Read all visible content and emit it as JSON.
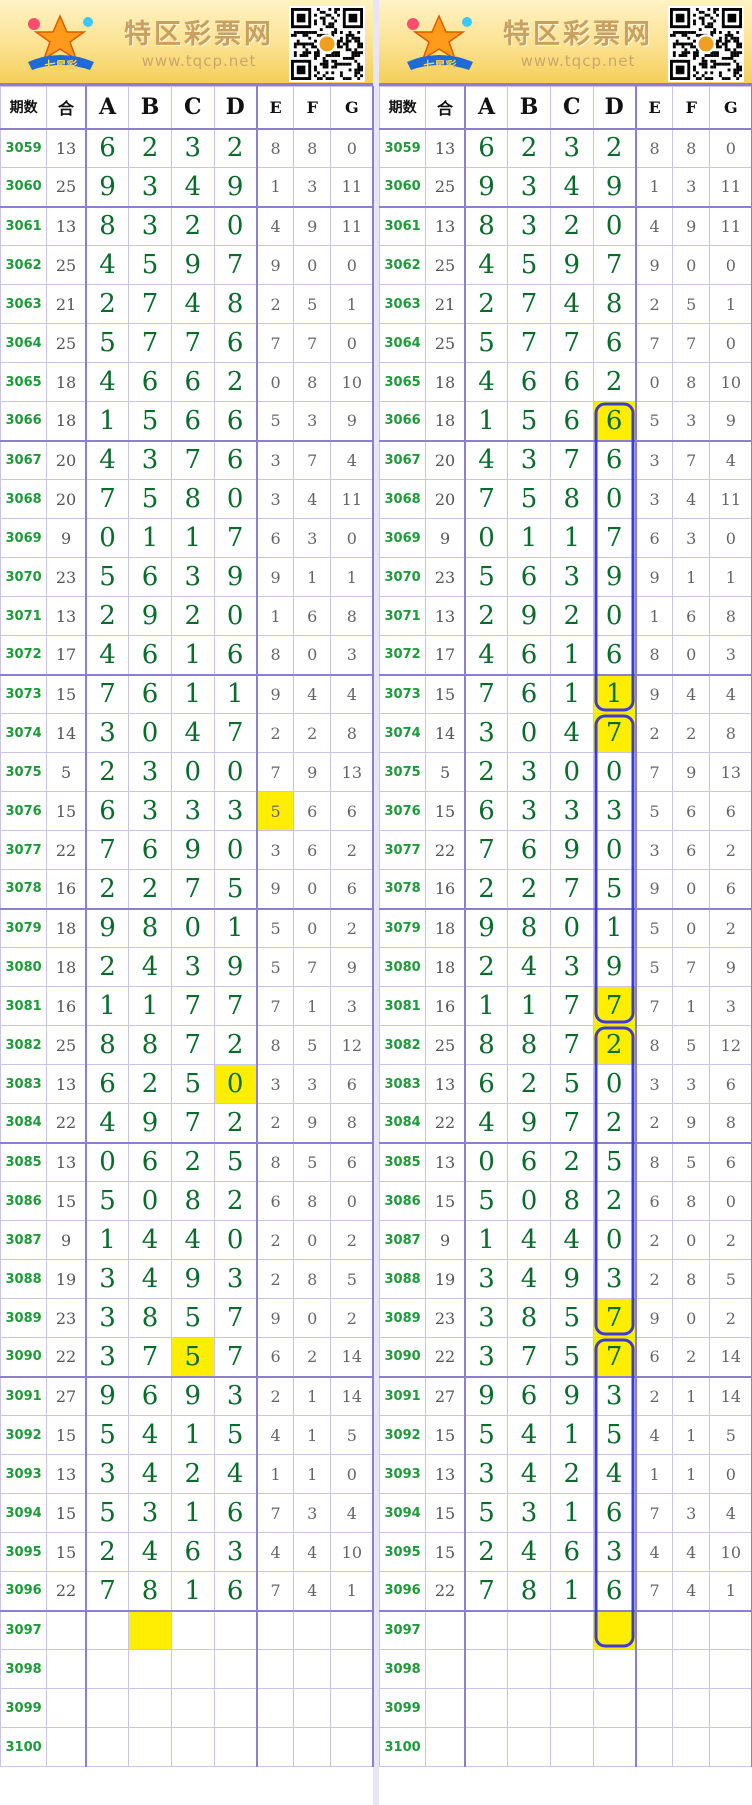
{
  "banner": {
    "title": "特区彩票网",
    "url": "www.tqcp.net",
    "logo_label": "七星彩"
  },
  "headers": [
    "期数",
    "合",
    "A",
    "B",
    "C",
    "D",
    "E",
    "F",
    "G"
  ],
  "rows": [
    {
      "p": "3059",
      "s": "13",
      "m": [
        "6",
        "2",
        "3",
        "2"
      ],
      "e": [
        "8",
        "8",
        "0"
      ]
    },
    {
      "p": "3060",
      "s": "25",
      "m": [
        "9",
        "3",
        "4",
        "9"
      ],
      "e": [
        "1",
        "3",
        "11"
      ]
    },
    {
      "p": "3061",
      "s": "13",
      "m": [
        "8",
        "3",
        "2",
        "0"
      ],
      "e": [
        "4",
        "9",
        "11"
      ]
    },
    {
      "p": "3062",
      "s": "25",
      "m": [
        "4",
        "5",
        "9",
        "7"
      ],
      "e": [
        "9",
        "0",
        "0"
      ]
    },
    {
      "p": "3063",
      "s": "21",
      "m": [
        "2",
        "7",
        "4",
        "8"
      ],
      "e": [
        "2",
        "5",
        "1"
      ]
    },
    {
      "p": "3064",
      "s": "25",
      "m": [
        "5",
        "7",
        "7",
        "6"
      ],
      "e": [
        "7",
        "7",
        "0"
      ]
    },
    {
      "p": "3065",
      "s": "18",
      "m": [
        "4",
        "6",
        "6",
        "2"
      ],
      "e": [
        "0",
        "8",
        "10"
      ]
    },
    {
      "p": "3066",
      "s": "18",
      "m": [
        "1",
        "5",
        "6",
        "6"
      ],
      "e": [
        "5",
        "3",
        "9"
      ]
    },
    {
      "p": "3067",
      "s": "20",
      "m": [
        "4",
        "3",
        "7",
        "6"
      ],
      "e": [
        "3",
        "7",
        "4"
      ]
    },
    {
      "p": "3068",
      "s": "20",
      "m": [
        "7",
        "5",
        "8",
        "0"
      ],
      "e": [
        "3",
        "4",
        "11"
      ]
    },
    {
      "p": "3069",
      "s": "9",
      "m": [
        "0",
        "1",
        "1",
        "7"
      ],
      "e": [
        "6",
        "3",
        "0"
      ]
    },
    {
      "p": "3070",
      "s": "23",
      "m": [
        "5",
        "6",
        "3",
        "9"
      ],
      "e": [
        "9",
        "1",
        "1"
      ]
    },
    {
      "p": "3071",
      "s": "13",
      "m": [
        "2",
        "9",
        "2",
        "0"
      ],
      "e": [
        "1",
        "6",
        "8"
      ]
    },
    {
      "p": "3072",
      "s": "17",
      "m": [
        "4",
        "6",
        "1",
        "6"
      ],
      "e": [
        "8",
        "0",
        "3"
      ]
    },
    {
      "p": "3073",
      "s": "15",
      "m": [
        "7",
        "6",
        "1",
        "1"
      ],
      "e": [
        "9",
        "4",
        "4"
      ]
    },
    {
      "p": "3074",
      "s": "14",
      "m": [
        "3",
        "0",
        "4",
        "7"
      ],
      "e": [
        "2",
        "2",
        "8"
      ]
    },
    {
      "p": "3075",
      "s": "5",
      "m": [
        "2",
        "3",
        "0",
        "0"
      ],
      "e": [
        "7",
        "9",
        "13"
      ]
    },
    {
      "p": "3076",
      "s": "15",
      "m": [
        "6",
        "3",
        "3",
        "3"
      ],
      "e": [
        "5",
        "6",
        "6"
      ]
    },
    {
      "p": "3077",
      "s": "22",
      "m": [
        "7",
        "6",
        "9",
        "0"
      ],
      "e": [
        "3",
        "6",
        "2"
      ]
    },
    {
      "p": "3078",
      "s": "16",
      "m": [
        "2",
        "2",
        "7",
        "5"
      ],
      "e": [
        "9",
        "0",
        "6"
      ]
    },
    {
      "p": "3079",
      "s": "18",
      "m": [
        "9",
        "8",
        "0",
        "1"
      ],
      "e": [
        "5",
        "0",
        "2"
      ]
    },
    {
      "p": "3080",
      "s": "18",
      "m": [
        "2",
        "4",
        "3",
        "9"
      ],
      "e": [
        "5",
        "7",
        "9"
      ]
    },
    {
      "p": "3081",
      "s": "16",
      "m": [
        "1",
        "1",
        "7",
        "7"
      ],
      "e": [
        "7",
        "1",
        "3"
      ]
    },
    {
      "p": "3082",
      "s": "25",
      "m": [
        "8",
        "8",
        "7",
        "2"
      ],
      "e": [
        "8",
        "5",
        "12"
      ]
    },
    {
      "p": "3083",
      "s": "13",
      "m": [
        "6",
        "2",
        "5",
        "0"
      ],
      "e": [
        "3",
        "3",
        "6"
      ]
    },
    {
      "p": "3084",
      "s": "22",
      "m": [
        "4",
        "9",
        "7",
        "2"
      ],
      "e": [
        "2",
        "9",
        "8"
      ]
    },
    {
      "p": "3085",
      "s": "13",
      "m": [
        "0",
        "6",
        "2",
        "5"
      ],
      "e": [
        "8",
        "5",
        "6"
      ]
    },
    {
      "p": "3086",
      "s": "15",
      "m": [
        "5",
        "0",
        "8",
        "2"
      ],
      "e": [
        "6",
        "8",
        "0"
      ]
    },
    {
      "p": "3087",
      "s": "9",
      "m": [
        "1",
        "4",
        "4",
        "0"
      ],
      "e": [
        "2",
        "0",
        "2"
      ]
    },
    {
      "p": "3088",
      "s": "19",
      "m": [
        "3",
        "4",
        "9",
        "3"
      ],
      "e": [
        "2",
        "8",
        "5"
      ]
    },
    {
      "p": "3089",
      "s": "23",
      "m": [
        "3",
        "8",
        "5",
        "7"
      ],
      "e": [
        "9",
        "0",
        "2"
      ]
    },
    {
      "p": "3090",
      "s": "22",
      "m": [
        "3",
        "7",
        "5",
        "7"
      ],
      "e": [
        "6",
        "2",
        "14"
      ]
    },
    {
      "p": "3091",
      "s": "27",
      "m": [
        "9",
        "6",
        "9",
        "3"
      ],
      "e": [
        "2",
        "1",
        "14"
      ]
    },
    {
      "p": "3092",
      "s": "15",
      "m": [
        "5",
        "4",
        "1",
        "5"
      ],
      "e": [
        "4",
        "1",
        "5"
      ]
    },
    {
      "p": "3093",
      "s": "13",
      "m": [
        "3",
        "4",
        "2",
        "4"
      ],
      "e": [
        "1",
        "1",
        "0"
      ]
    },
    {
      "p": "3094",
      "s": "15",
      "m": [
        "5",
        "3",
        "1",
        "6"
      ],
      "e": [
        "7",
        "3",
        "4"
      ]
    },
    {
      "p": "3095",
      "s": "15",
      "m": [
        "2",
        "4",
        "6",
        "3"
      ],
      "e": [
        "4",
        "4",
        "10"
      ]
    },
    {
      "p": "3096",
      "s": "22",
      "m": [
        "7",
        "8",
        "1",
        "6"
      ],
      "e": [
        "7",
        "4",
        "1"
      ]
    },
    {
      "p": "3097",
      "s": "",
      "m": [
        "",
        "",
        "",
        ""
      ],
      "e": [
        "",
        "",
        ""
      ]
    },
    {
      "p": "3098",
      "s": "",
      "m": [
        "",
        "",
        "",
        ""
      ],
      "e": [
        "",
        "",
        ""
      ]
    },
    {
      "p": "3099",
      "s": "",
      "m": [
        "",
        "",
        "",
        ""
      ],
      "e": [
        "",
        "",
        ""
      ]
    },
    {
      "p": "3100",
      "s": "",
      "m": [
        "",
        "",
        "",
        ""
      ],
      "e": [
        "",
        "",
        ""
      ]
    }
  ],
  "left_highlights": [
    {
      "period": "3076",
      "col": "E"
    },
    {
      "period": "3083",
      "col": "D"
    },
    {
      "period": "3090",
      "col": "C"
    },
    {
      "period": "3097",
      "col": "B"
    }
  ],
  "right_highlights": [
    {
      "period": "3066",
      "col": "D"
    },
    {
      "period": "3073",
      "col": "D"
    },
    {
      "period": "3074",
      "col": "D"
    },
    {
      "period": "3081",
      "col": "D"
    },
    {
      "period": "3082",
      "col": "D"
    },
    {
      "period": "3089",
      "col": "D"
    },
    {
      "period": "3090",
      "col": "D"
    },
    {
      "period": "3097",
      "col": "D"
    }
  ],
  "right_circled_ranges": [
    {
      "col": "D",
      "from": "3066",
      "to": "3073"
    },
    {
      "col": "D",
      "from": "3074",
      "to": "3081"
    },
    {
      "col": "D",
      "from": "3082",
      "to": "3089"
    },
    {
      "col": "D",
      "from": "3090",
      "to": "3097"
    }
  ],
  "colors": {
    "highlight": "#ffee00",
    "circle": "#3b3bd6",
    "period_text": "#1e9a3a",
    "main_digit": "#0b6b2c"
  }
}
